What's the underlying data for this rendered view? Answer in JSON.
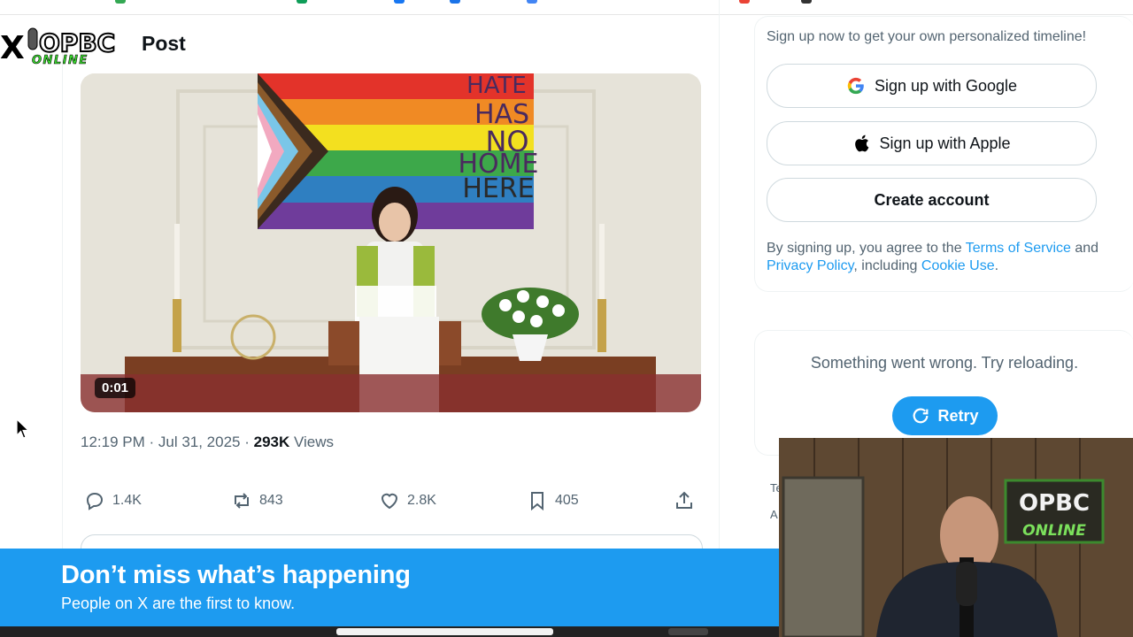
{
  "header": {
    "logo_text_top": "OPBC",
    "logo_text_bottom": "ONLINE",
    "title": "Post"
  },
  "video": {
    "timestamp": "0:01",
    "banner_lines": [
      "HATE",
      "HAS",
      "NO",
      "HOME",
      "HERE"
    ]
  },
  "meta": {
    "time_date": "12:19 PM · Jul 31, 2025 · ",
    "views_count": "293K",
    "views_label": " Views"
  },
  "actions": {
    "replies": "1.4K",
    "reposts": "843",
    "likes": "2.8K",
    "bookmarks": "405"
  },
  "sidebar": {
    "signup_hint": "Sign up now to get your own personalized timeline!",
    "google_label": "Sign up with Google",
    "apple_label": "Sign up with Apple",
    "create_label": "Create account",
    "terms_prefix": "By signing up, you agree to the ",
    "terms_link": "Terms of Service",
    "terms_and": " and ",
    "privacy_link": "Privacy Policy",
    "terms_including": ", including ",
    "cookie_link": "Cookie Use",
    "terms_end": ".",
    "error_text": "Something went wrong. Try reloading.",
    "retry_label": "Retry",
    "frag_1": "Te",
    "frag_2": "A"
  },
  "banner": {
    "title": "Don’t miss what’s happening",
    "subtitle": "People on X are the first to know."
  },
  "webcam": {
    "sign_top": "OPBC",
    "sign_bottom": "ONLINE"
  },
  "colors": {
    "accent": "#1d9bf0",
    "text_primary": "#0f1419",
    "text_secondary": "#536471"
  }
}
